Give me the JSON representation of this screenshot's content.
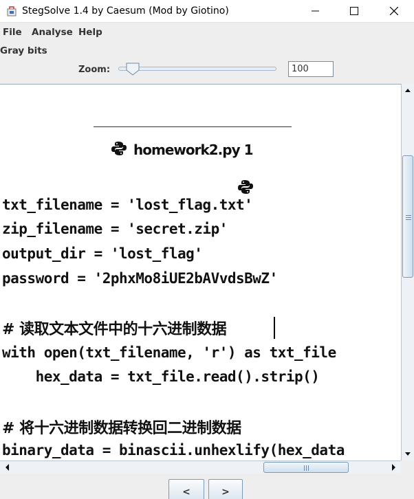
{
  "window": {
    "title": "StegSolve 1.4 by Caesum (Mod by Giotino)"
  },
  "menu": {
    "file": "File",
    "analyse": "Analyse",
    "help": "Help"
  },
  "view": {
    "label": "Gray bits"
  },
  "zoom": {
    "label": "Zoom:",
    "value": "100",
    "slider_level": 0.09
  },
  "image_content": {
    "tab_title": "homework2.py 1",
    "lines": [
      "txt_filename = 'lost_flag.txt'",
      "zip_filename = 'secret.zip'",
      "output_dir = 'lost_flag'",
      "password = '2phxMo8iUE2bAVvdsBwZ'",
      "# 读取文本文件中的十六进制数据",
      "with open(txt_filename, 'r') as txt_file",
      "    hex_data = txt_file.read().strip()",
      "# 将十六进制数据转换回二进制数据",
      "binary_data = binascii.unhexlify(hex_data"
    ]
  },
  "buttons": {
    "prev": "<",
    "next": ">"
  },
  "icons": {
    "app": "steg-app-icon",
    "minimize": "minimize-icon",
    "maximize": "maximize-icon",
    "close": "close-icon",
    "python": "python-icon"
  }
}
